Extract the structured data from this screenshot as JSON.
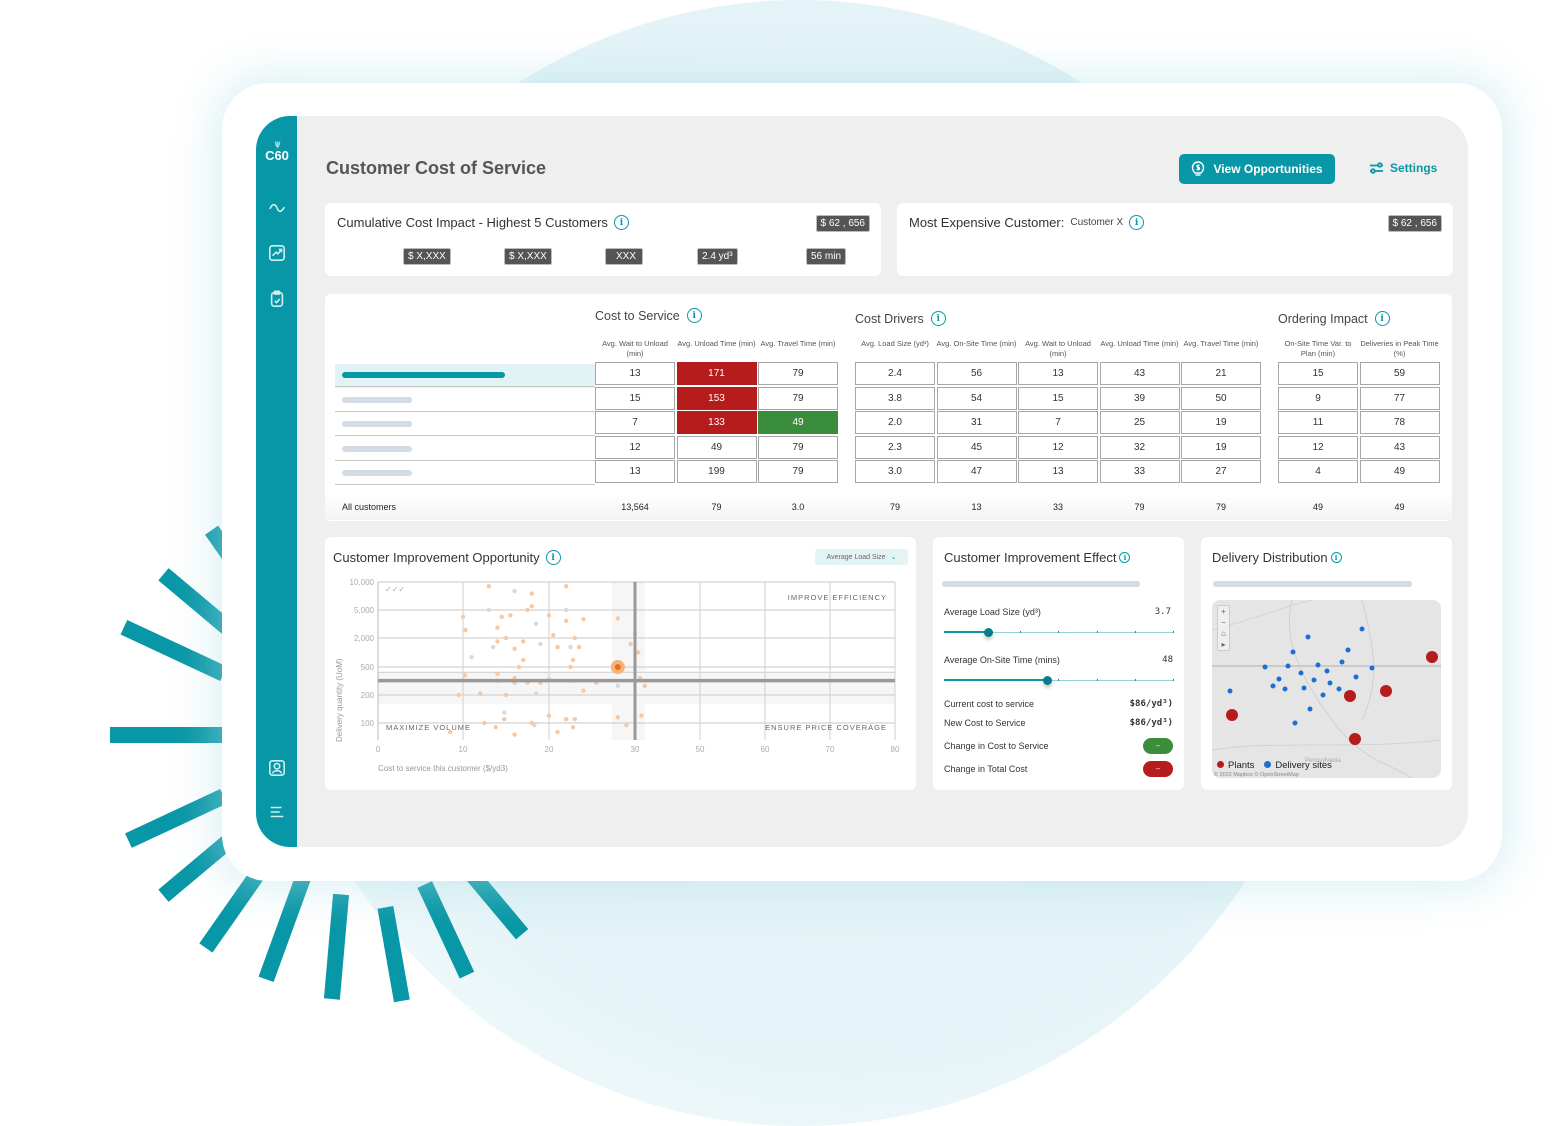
{
  "app": {
    "logo_text": "C60",
    "logo_rays": "\\\\|//"
  },
  "sidebar": {
    "items": [
      {
        "name": "sidebar-item-trends",
        "icon": "wave-icon"
      },
      {
        "name": "sidebar-item-analytics",
        "icon": "chart-up-icon"
      },
      {
        "name": "sidebar-item-tasks",
        "icon": "clipboard-check-icon"
      },
      {
        "name": "sidebar-item-profile",
        "icon": "user-card-icon"
      },
      {
        "name": "sidebar-item-menu",
        "icon": "menu-icon"
      }
    ]
  },
  "header": {
    "title": "Customer Cost of Service",
    "view_button": "View Opportunities",
    "settings_button": "Settings"
  },
  "cumulative": {
    "title": "Cumulative Cost Impact - Highest 5 Customers",
    "total": "$ 62 , 656",
    "kpis": [
      "$ X,XXX",
      "$ X,XXX",
      "XXX",
      "2.4 yd³",
      "56 min"
    ]
  },
  "most_expensive": {
    "label": "Most Expensive Customer:",
    "customer": "Customer X",
    "total": "$ 62 , 656"
  },
  "table": {
    "groups": [
      {
        "title": "Cost to Service",
        "columns": [
          "Avg. Wait to Unload (min)",
          "Avg. Unload Time (min)",
          "Avg. Travel Time (min)"
        ],
        "rows": [
          [
            "13",
            "171",
            "79"
          ],
          [
            "15",
            "153",
            "79"
          ],
          [
            "7",
            "133",
            "49"
          ],
          [
            "12",
            "49",
            "79"
          ],
          [
            "13",
            "199",
            "79"
          ]
        ],
        "highlight": [
          [
            "",
            "red",
            ""
          ],
          [
            "",
            "red",
            ""
          ],
          [
            "",
            "red",
            "green"
          ],
          [
            "",
            "",
            ""
          ],
          [
            "",
            "",
            ""
          ]
        ],
        "totals": [
          "13,564",
          "79",
          "3.0"
        ]
      },
      {
        "title": "Cost Drivers",
        "columns": [
          "Avg. Load Size (yd³)",
          "Avg. On-Site Time (min)",
          "Avg. Wait to Unload (min)",
          "Avg. Unload Time (min)",
          "Avg. Travel Time (min)"
        ],
        "rows": [
          [
            "2.4",
            "56",
            "13",
            "43",
            "21"
          ],
          [
            "3.8",
            "54",
            "15",
            "39",
            "50"
          ],
          [
            "2.0",
            "31",
            "7",
            "25",
            "19"
          ],
          [
            "2.3",
            "45",
            "12",
            "32",
            "19"
          ],
          [
            "3.0",
            "47",
            "13",
            "33",
            "27"
          ]
        ],
        "totals": [
          "79",
          "13",
          "33",
          "79",
          "79"
        ]
      },
      {
        "title": "Ordering Impact",
        "columns": [
          "On-Site Time Var. to Plan (min)",
          "Deliveries in Peak Time (%)"
        ],
        "rows": [
          [
            "15",
            "59"
          ],
          [
            "9",
            "77"
          ],
          [
            "11",
            "78"
          ],
          [
            "12",
            "43"
          ],
          [
            "4",
            "49"
          ]
        ],
        "totals": [
          "49",
          "49"
        ]
      }
    ],
    "total_label": "All customers",
    "selected_row": 0
  },
  "opportunity": {
    "title": "Customer Improvement Opportunity",
    "dropdown": "Average Load Size",
    "quadrants": {
      "top_right": "IMPROVE EFFICIENCY",
      "bottom_left": "MAXIMIZE VOLUME",
      "bottom_right": "ENSURE PRICE COVERAGE"
    },
    "check_marks": "✓✓✓"
  },
  "chart_data": {
    "type": "scatter",
    "title": "Customer Improvement Opportunity",
    "xlabel": "Cost to service this customer ($/yd3)",
    "ylabel": "Delivery quantity (UoM)",
    "x_ticks": [
      "0",
      "10",
      "20",
      "30",
      "50",
      "60",
      "70",
      "80"
    ],
    "y_ticks": [
      "10,000",
      "5,000",
      "2,000",
      "500",
      "200",
      "100"
    ],
    "x_tick_values": [
      0,
      10,
      20,
      30,
      50,
      60,
      70,
      80
    ],
    "y_tick_values": [
      10000,
      5000,
      2000,
      500,
      200,
      100
    ],
    "grid": true,
    "reference_lines": {
      "x": 30,
      "y": 320
    },
    "highlighted_point": {
      "x": 28,
      "y": 500
    },
    "points": [
      [
        13,
        9000,
        "o"
      ],
      [
        16,
        8000,
        "g"
      ],
      [
        18,
        7500,
        "o"
      ],
      [
        22,
        9000,
        "o"
      ],
      [
        13,
        5000,
        "g"
      ],
      [
        17.5,
        5000,
        "o"
      ],
      [
        18,
        5500,
        "o"
      ],
      [
        22,
        5000,
        "g"
      ],
      [
        10,
        4000,
        "o"
      ],
      [
        14.5,
        4000,
        "o"
      ],
      [
        15.5,
        4200,
        "o"
      ],
      [
        20,
        4200,
        "o"
      ],
      [
        22,
        3500,
        "o"
      ],
      [
        24,
        3700,
        "o"
      ],
      [
        28,
        3800,
        "o"
      ],
      [
        18.5,
        3200,
        "g"
      ],
      [
        10.3,
        2600,
        "o"
      ],
      [
        14,
        2800,
        "o"
      ],
      [
        20.5,
        2200,
        "o"
      ],
      [
        15,
        2000,
        "o"
      ],
      [
        23,
        2000,
        "o"
      ],
      [
        14,
        1700,
        "o"
      ],
      [
        17,
        1700,
        "o"
      ],
      [
        19,
        1500,
        "g"
      ],
      [
        13.5,
        1300,
        "g"
      ],
      [
        16,
        1200,
        "o"
      ],
      [
        21,
        1300,
        "o"
      ],
      [
        22.5,
        1300,
        "g"
      ],
      [
        23.5,
        1300,
        "o"
      ],
      [
        30,
        2300,
        "o"
      ],
      [
        29.5,
        1500,
        "o"
      ],
      [
        31,
        1000,
        "o"
      ],
      [
        11,
        800,
        "g"
      ],
      [
        17,
        700,
        "o"
      ],
      [
        22.8,
        700,
        "o"
      ],
      [
        16.5,
        500,
        "o"
      ],
      [
        22.5,
        500,
        "o"
      ],
      [
        10.2,
        380,
        "o"
      ],
      [
        14,
        400,
        "o"
      ],
      [
        16,
        350,
        "o"
      ],
      [
        14,
        320,
        "o"
      ],
      [
        16,
        300,
        "o"
      ],
      [
        17.5,
        300,
        "o"
      ],
      [
        19,
        300,
        "o"
      ],
      [
        20,
        340,
        "g"
      ],
      [
        22.5,
        320,
        "o"
      ],
      [
        25.5,
        300,
        "o"
      ],
      [
        31.5,
        350,
        "o"
      ],
      [
        28,
        270,
        "g"
      ],
      [
        9.5,
        200,
        "o"
      ],
      [
        12,
        210,
        "o"
      ],
      [
        15,
        200,
        "o"
      ],
      [
        18.5,
        210,
        "g"
      ],
      [
        24,
        230,
        "o"
      ],
      [
        33,
        270,
        "o"
      ],
      [
        14.8,
        130,
        "g"
      ],
      [
        20,
        120,
        "o"
      ],
      [
        14.8,
        110,
        "o"
      ],
      [
        18,
        100,
        "o"
      ],
      [
        18.3,
        95,
        "g"
      ],
      [
        22,
        110,
        "o"
      ],
      [
        23,
        110,
        "o"
      ],
      [
        28,
        115,
        "o"
      ],
      [
        29,
        95,
        "o"
      ],
      [
        32,
        120,
        "o"
      ],
      [
        12.5,
        100,
        "o"
      ],
      [
        13.8,
        90,
        "o"
      ],
      [
        22.8,
        90,
        "o"
      ],
      [
        8.5,
        80,
        "o"
      ],
      [
        16,
        75,
        "o"
      ],
      [
        21,
        80,
        "o"
      ]
    ]
  },
  "effect": {
    "title": "Customer Improvement Effect",
    "load_label": "Average Load Size (yd³)",
    "load_value": "3.7",
    "load_fraction": 0.19,
    "onsite_label": "Average On-Site Time (mins)",
    "onsite_value": "48",
    "onsite_fraction": 0.45,
    "current_label": "Current cost to service",
    "current_value": "$86/yd³)",
    "new_label": "New Cost to Service",
    "new_value": "$86/yd³)",
    "change_cost_label": "Change in Cost to Service",
    "change_cost_value": "--",
    "change_total_label": "Change in Total Cost",
    "change_total_value": "--",
    "colors": {
      "positive": "#3a8d3a",
      "negative": "#b71c1c"
    }
  },
  "distribution": {
    "title": "Delivery Distribution",
    "legend_plants": "Plants",
    "legend_sites": "Delivery sites",
    "attribution": "© 2022 Mapbox  © OpenStreetMap",
    "state_label": "Pennsylvania",
    "map_controls": [
      "+",
      "−",
      "⌂",
      "▸"
    ],
    "colors": {
      "plants": "#b71c1c",
      "sites": "#1a6fd6"
    }
  }
}
